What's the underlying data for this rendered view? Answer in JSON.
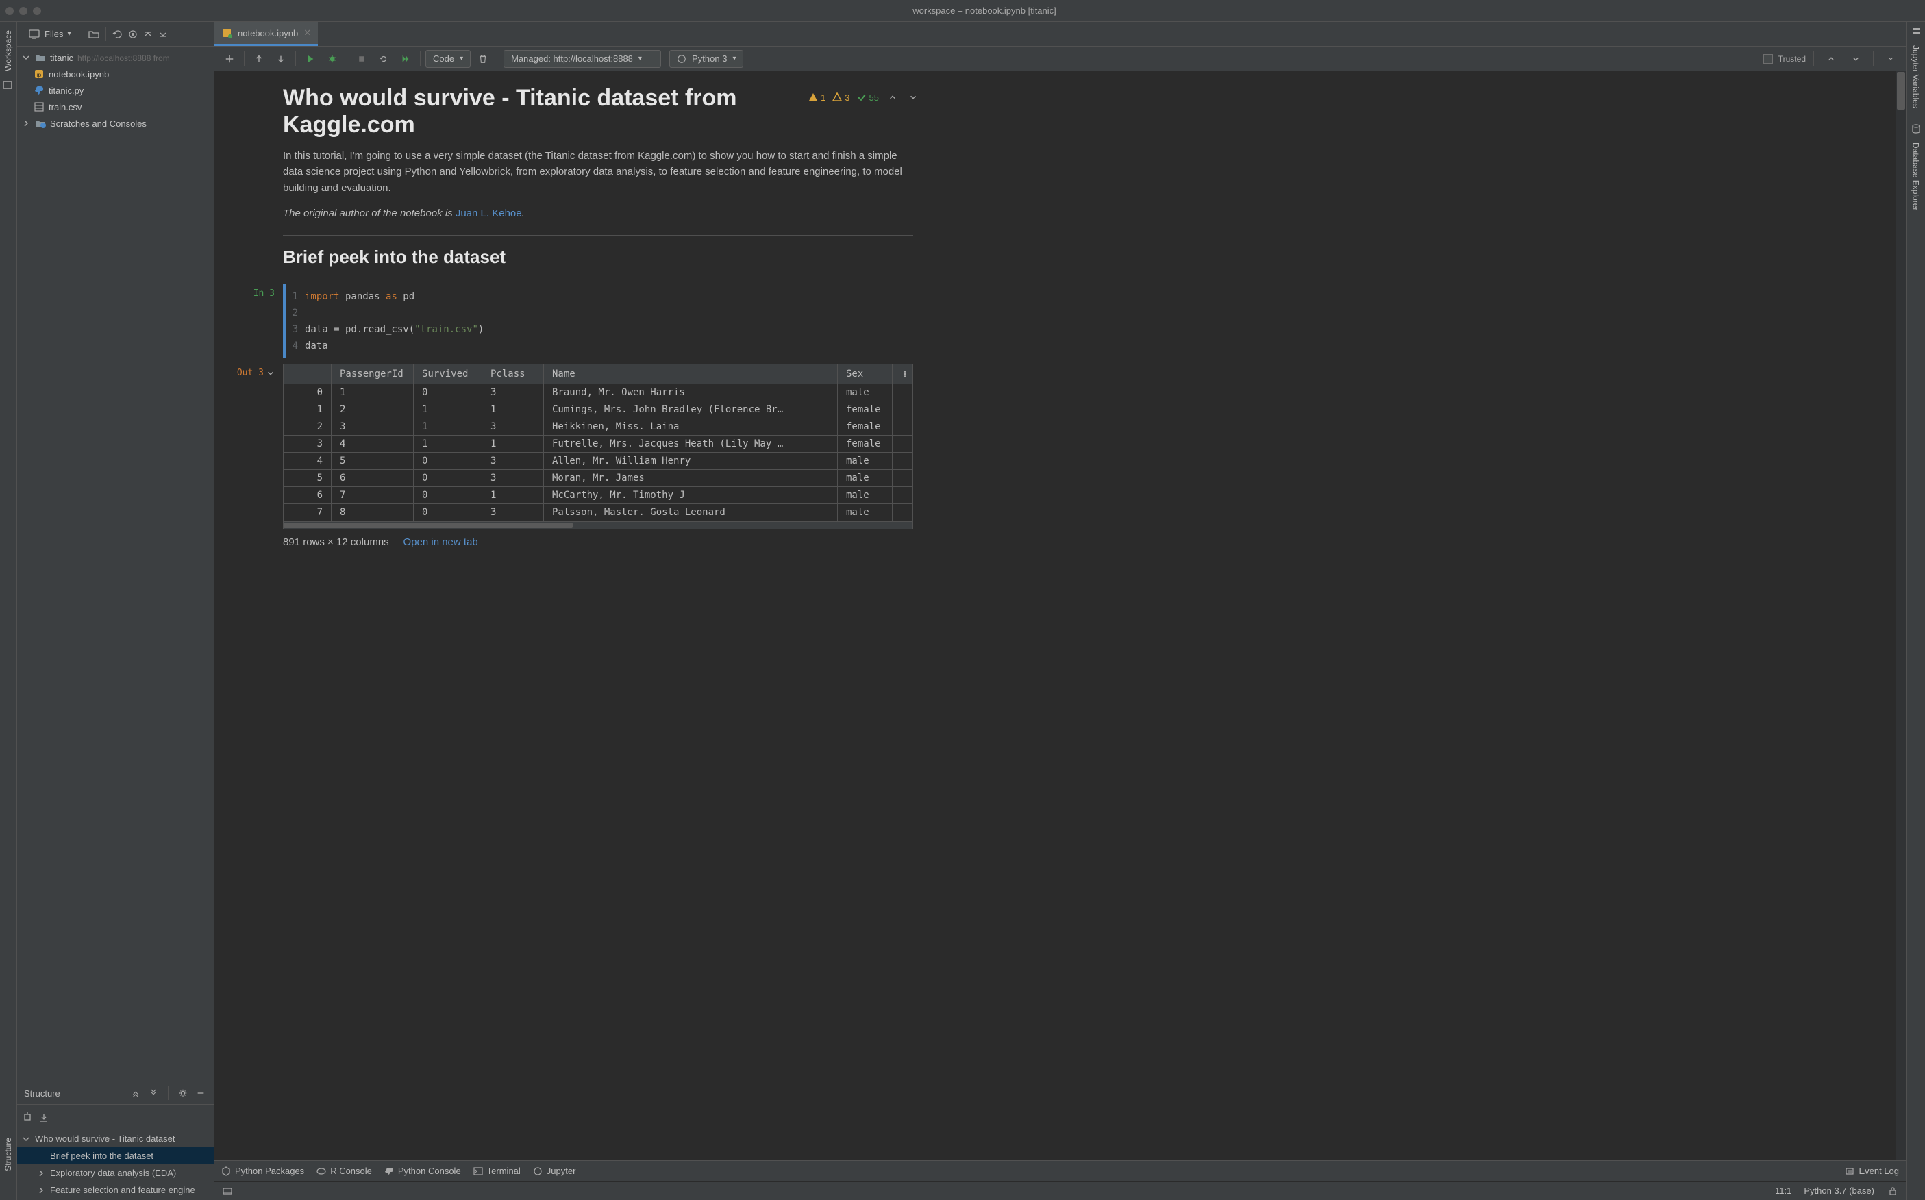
{
  "window": {
    "title": "workspace – notebook.ipynb [titanic]"
  },
  "sidebar": {
    "files_label": "Files",
    "project": {
      "name": "titanic",
      "url": "http://localhost:8888 from"
    },
    "files": [
      {
        "name": "notebook.ipynb"
      },
      {
        "name": "titanic.py"
      },
      {
        "name": "train.csv"
      }
    ],
    "scratches_label": "Scratches and Consoles"
  },
  "structure": {
    "title": "Structure",
    "items": [
      {
        "label": "Who would survive - Titanic dataset",
        "level": 0,
        "expanded": true,
        "selected": false
      },
      {
        "label": "Brief peek into the dataset",
        "level": 1,
        "selected": true
      },
      {
        "label": "Exploratory data analysis (EDA)",
        "level": 1,
        "expandable": true
      },
      {
        "label": "Feature selection and feature engine",
        "level": 1,
        "expandable": true
      }
    ]
  },
  "editor": {
    "tab_label": "notebook.ipynb"
  },
  "toolbar": {
    "cell_type": "Code",
    "kernel_label": "Managed: http://localhost:8888",
    "interpreter_label": "Python 3",
    "trusted_label": "Trusted"
  },
  "notebook": {
    "h1": "Who would survive - Titanic dataset from Kaggle.com",
    "stats": {
      "warn1": "1",
      "warn2": "3",
      "ok": "55"
    },
    "intro_p": "In this tutorial, I'm going to use a very simple dataset (the Titanic dataset from Kaggle.com) to show you how to start and finish a simple data science project using Python and Yellowbrick, from exploratory data analysis, to feature selection and feature engineering, to model building and evaluation.",
    "credit_prefix": "The original author of the notebook is ",
    "credit_link": "Juan L. Kehoe",
    "credit_suffix": ".",
    "h2": "Brief peek into the dataset",
    "in_label": "In 3",
    "out_label": "Out 3",
    "code_lines": [
      {
        "n": "1",
        "html": "<span class='kw'>import</span> pandas <span class='kw'>as</span> pd"
      },
      {
        "n": "2",
        "html": ""
      },
      {
        "n": "3",
        "html": "data = pd.read_csv(<span class='str'>\"train.csv\"</span>)"
      },
      {
        "n": "4",
        "html": "data"
      }
    ],
    "table_summary": "891 rows × 12 columns",
    "open_tab_label": "Open in new tab"
  },
  "chart_data": {
    "type": "table",
    "columns": [
      "PassengerId",
      "Survived",
      "Pclass",
      "Name",
      "Sex"
    ],
    "rows": [
      {
        "idx": "0",
        "PassengerId": "1",
        "Survived": "0",
        "Pclass": "3",
        "Name": "Braund, Mr. Owen Harris",
        "Sex": "male"
      },
      {
        "idx": "1",
        "PassengerId": "2",
        "Survived": "1",
        "Pclass": "1",
        "Name": "Cumings, Mrs. John Bradley (Florence Br…",
        "Sex": "female"
      },
      {
        "idx": "2",
        "PassengerId": "3",
        "Survived": "1",
        "Pclass": "3",
        "Name": "Heikkinen, Miss. Laina",
        "Sex": "female"
      },
      {
        "idx": "3",
        "PassengerId": "4",
        "Survived": "1",
        "Pclass": "1",
        "Name": "Futrelle, Mrs. Jacques Heath (Lily May …",
        "Sex": "female"
      },
      {
        "idx": "4",
        "PassengerId": "5",
        "Survived": "0",
        "Pclass": "3",
        "Name": "Allen, Mr. William Henry",
        "Sex": "male"
      },
      {
        "idx": "5",
        "PassengerId": "6",
        "Survived": "0",
        "Pclass": "3",
        "Name": "Moran, Mr. James",
        "Sex": "male"
      },
      {
        "idx": "6",
        "PassengerId": "7",
        "Survived": "0",
        "Pclass": "1",
        "Name": "McCarthy, Mr. Timothy J",
        "Sex": "male"
      },
      {
        "idx": "7",
        "PassengerId": "8",
        "Survived": "0",
        "Pclass": "3",
        "Name": "Palsson, Master. Gosta Leonard",
        "Sex": "male"
      }
    ]
  },
  "left_tabs": {
    "workspace": "Workspace",
    "structure": "Structure"
  },
  "right_tabs": {
    "vars": "Jupyter Variables",
    "db": "Database Explorer"
  },
  "bottom": {
    "python_packages": "Python Packages",
    "r_console": "R Console",
    "python_console": "Python Console",
    "terminal": "Terminal",
    "jupyter": "Jupyter",
    "event_log": "Event Log"
  },
  "status": {
    "line_col": "11:1",
    "interpreter": "Python 3.7 (base)"
  }
}
